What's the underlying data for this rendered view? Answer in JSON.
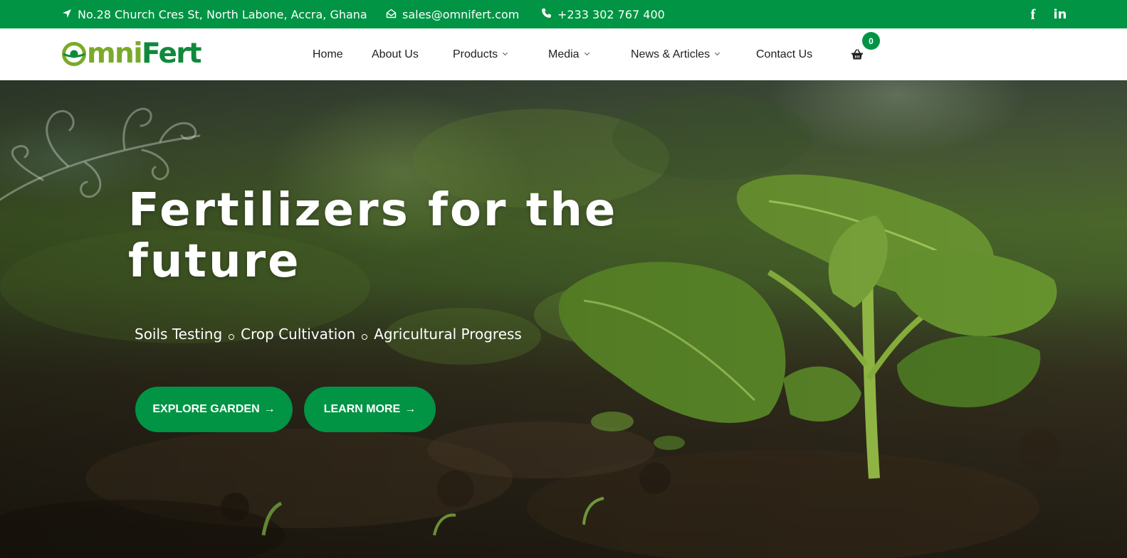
{
  "topbar": {
    "address": "No.28 Church Cres St, North Labone, Accra, Ghana",
    "email": "sales@omnifert.com",
    "phone": "+233 302 767 400",
    "icons": {
      "address": "location-arrow-icon",
      "email": "envelope-open-icon",
      "phone": "phone-icon",
      "facebook": "facebook-icon",
      "linkedin": "linkedin-icon"
    },
    "social": {
      "facebook": "f",
      "linkedin": "in"
    }
  },
  "header": {
    "logo": {
      "part1": "mni",
      "part2": "Fert"
    },
    "nav": [
      {
        "label": "Home"
      },
      {
        "label": "About Us"
      },
      {
        "label": "Products",
        "dropdown": true
      },
      {
        "label": "Media",
        "dropdown": true
      },
      {
        "label": "News & Articles",
        "dropdown": true
      },
      {
        "label": "Contact Us"
      }
    ],
    "cart": {
      "icon": "basket-icon",
      "count": "0"
    }
  },
  "hero": {
    "title_line1": "Fertilizers for the",
    "title_line2": "future",
    "tags": [
      "Soils Testing",
      "Crop Cultivation",
      "Agricultural Progress"
    ],
    "buttons": [
      {
        "label": "EXPLORE GARDEN",
        "icon": "arrow-right-icon",
        "arrow": "→"
      },
      {
        "label": "LEARN MORE",
        "icon": "arrow-right-icon",
        "arrow": "→"
      }
    ]
  },
  "colors": {
    "brand_green": "#009444",
    "logo_light_green": "#7aaa2a",
    "logo_dark_green": "#0f8a3c",
    "text_dark": "#1f1f1f",
    "white": "#ffffff"
  }
}
